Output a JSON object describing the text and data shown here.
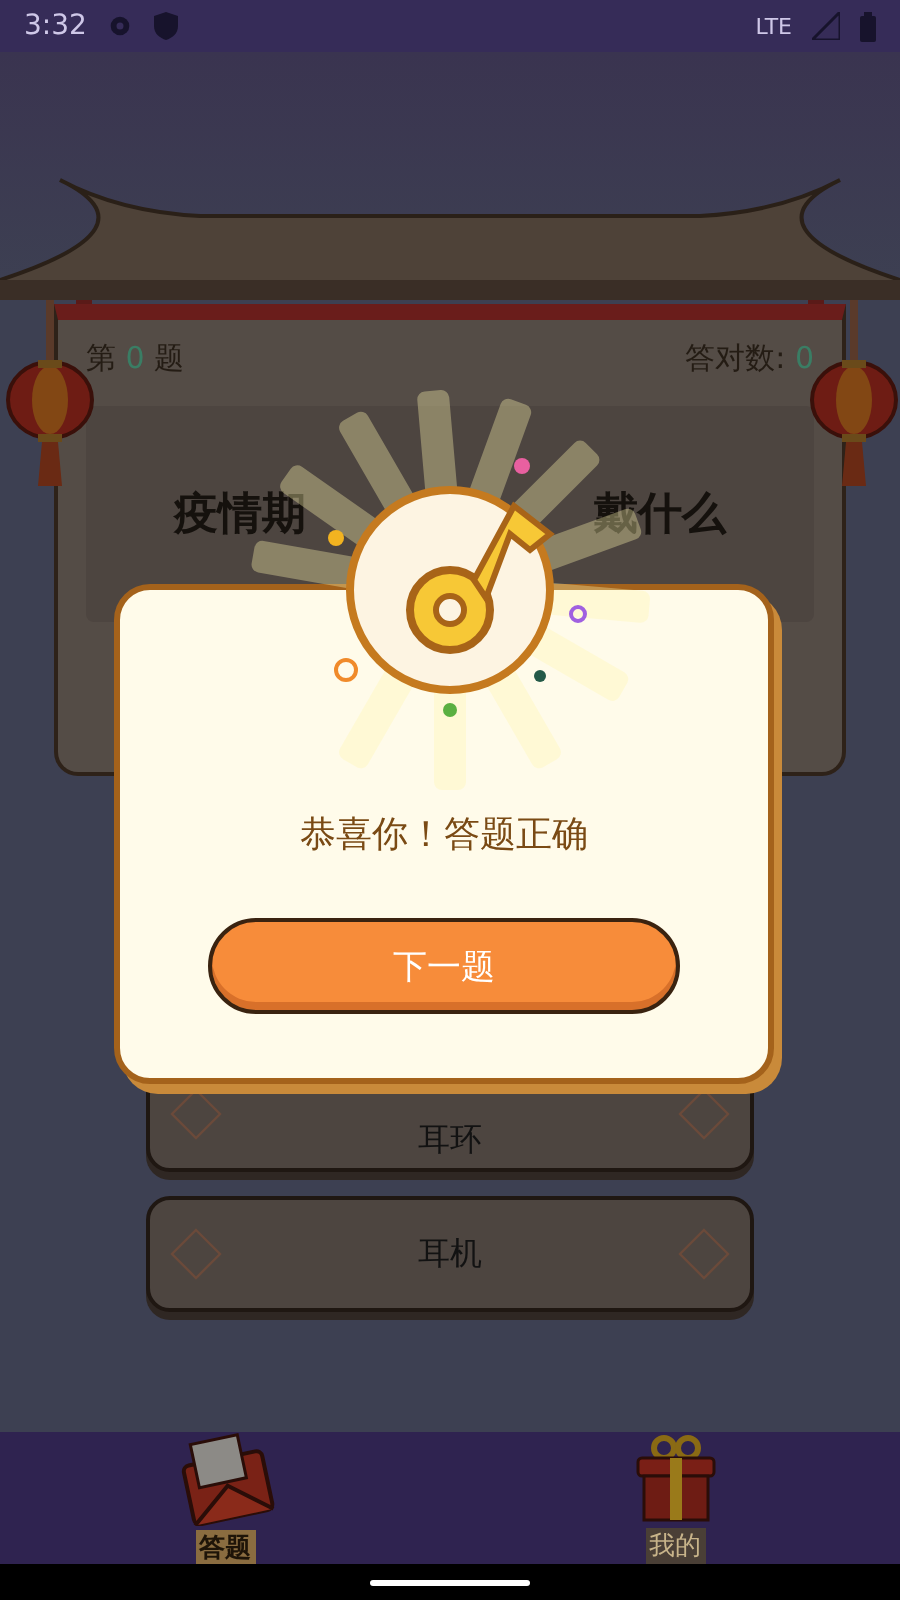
{
  "status_bar": {
    "time": "3:32",
    "network": "LTE"
  },
  "board": {
    "counter": {
      "prefix": "第",
      "number": "0",
      "suffix": "题"
    },
    "score": {
      "label": "答对数:",
      "number": "0"
    },
    "question_parts": [
      "疫情期",
      "戴什么"
    ]
  },
  "options": [
    {
      "label": "耳环"
    },
    {
      "label": "耳机"
    }
  ],
  "dialog": {
    "message": "恭喜你！答题正确",
    "button": "下一题"
  },
  "nav": [
    {
      "label": "答题",
      "selected": true,
      "kind": "envelope"
    },
    {
      "label": "我的",
      "selected": false,
      "kind": "gift"
    }
  ]
}
